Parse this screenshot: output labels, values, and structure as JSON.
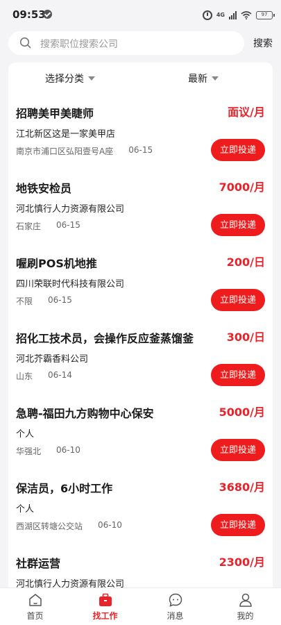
{
  "status": {
    "time": "09:53",
    "network": "4G",
    "battery": "97"
  },
  "search": {
    "placeholder": "搜索职位搜索公司",
    "button_label": "搜索"
  },
  "filters": {
    "category_label": "选择分类",
    "sort_label": "最新"
  },
  "colors": {
    "accent": "#e8242a",
    "button": "#ee1c1c"
  },
  "apply_label": "立即投递",
  "jobs": [
    {
      "title": "招聘美甲美睫师",
      "salary": "面议/月",
      "company": "江北新区这是一家美甲店",
      "location": "南京市浦口区弘阳壹号A座",
      "date": "06-15"
    },
    {
      "title": "地铁安检员",
      "salary": "7000/月",
      "company": "河北慎行人力资源有限公司",
      "location": "石家庄",
      "date": "06-15"
    },
    {
      "title": "喔刷POS机地推",
      "salary": "200/日",
      "company": "四川荣联时代科技有限公司",
      "location": "不限",
      "date": "06-15"
    },
    {
      "title": "招化工技术员，会操作反应釜蒸馏釜",
      "salary": "300/日",
      "company": "河北芥霸香料公司",
      "location": "山东",
      "date": "06-14"
    },
    {
      "title": "急聘-福田九方购物中心保安",
      "salary": "5000/月",
      "company": "个人",
      "location": "华强北",
      "date": "06-10"
    },
    {
      "title": "保洁员，6小时工作",
      "salary": "3680/月",
      "company": "个人",
      "location": "西湖区转塘公交站",
      "date": "06-10"
    },
    {
      "title": "社群运营",
      "salary": "2300/月",
      "company": "河北慎行人力资源有限公司",
      "location": "",
      "date": ""
    }
  ],
  "tabs": [
    {
      "label": "首页",
      "icon": "home-icon"
    },
    {
      "label": "找工作",
      "icon": "briefcase-icon",
      "active": true
    },
    {
      "label": "消息",
      "icon": "message-icon"
    },
    {
      "label": "我的",
      "icon": "profile-icon"
    }
  ]
}
